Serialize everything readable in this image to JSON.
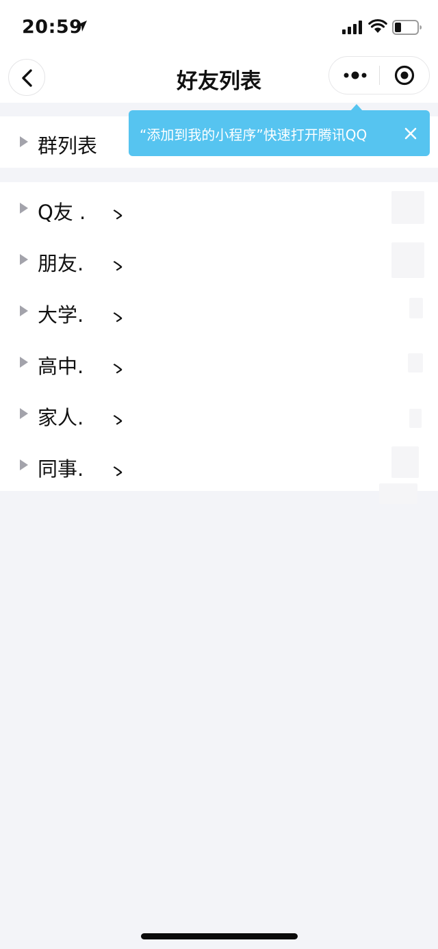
{
  "status_bar": {
    "time": "20:59",
    "location_icon": "location-arrow-icon",
    "signal_icon": "signal-bars-icon",
    "wifi_icon": "wifi-icon",
    "battery_icon": "battery-low-icon"
  },
  "nav": {
    "title": "好友列表",
    "back_icon": "chevron-left-icon",
    "more_icon": "more-dots-icon",
    "close_icon": "target-circle-icon"
  },
  "tooltip": {
    "text": "“添加到我的小程序”快速打开腾讯QQ",
    "close_icon": "close-icon"
  },
  "groups_section": {
    "items": [
      {
        "label": "群列表"
      }
    ]
  },
  "friends_section": {
    "items": [
      {
        "label": "Q友 .",
        "mark": "ゝ"
      },
      {
        "label": "朋友.",
        "mark": "ゝ"
      },
      {
        "label": "大学.",
        "mark": "ゝ"
      },
      {
        "label": "高中.",
        "mark": "ゝ"
      },
      {
        "label": "家人.",
        "mark": "ゝ"
      },
      {
        "label": "同事.",
        "mark": "ゝ"
      }
    ]
  },
  "colors": {
    "background": "#f3f4f8",
    "tooltip": "#56c4f0",
    "arrow": "#a3a3ab"
  }
}
